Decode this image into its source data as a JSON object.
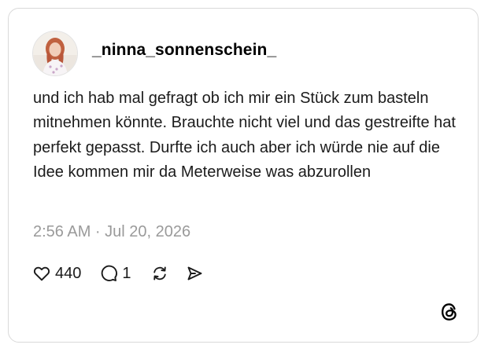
{
  "post": {
    "username": "_ninna_sonnenschein_",
    "text": "und ich hab mal gefragt ob ich mir ein Stück zum basteln mitnehmen könnte. Brauchte nicht viel und das gestreifte hat perfekt gepasst. Durfte ich auch aber ich würde nie auf die Idee kommen mir da Meterweise was abzurollen",
    "timestamp": "2:56 AM · Jul 20, 2026"
  },
  "actions": {
    "likes": "440",
    "replies": "1"
  },
  "icons": {
    "like": "heart-icon",
    "reply": "speech-bubble-icon",
    "repost": "repost-icon",
    "share": "send-icon",
    "brand": "threads-logo-icon",
    "avatar": "profile-photo"
  },
  "colors": {
    "text": "#1a1a1a",
    "muted": "#9a9a9a",
    "border": "#d9d9d9",
    "background": "#ffffff"
  }
}
